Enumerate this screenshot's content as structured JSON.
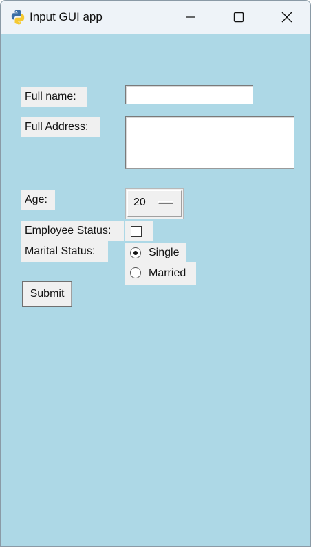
{
  "window": {
    "title": "Input GUI app",
    "app_icon": "python-icon",
    "controls": [
      "minimize-icon",
      "maximize-icon",
      "close-icon"
    ],
    "background_color": "#add8e6"
  },
  "form": {
    "full_name": {
      "label": "Full name:",
      "value": ""
    },
    "full_address": {
      "label": "Full Address:",
      "value": ""
    },
    "age": {
      "label": "Age:",
      "selected": "20"
    },
    "employee_status": {
      "label": "Employee Status:",
      "checked": false
    },
    "marital_status": {
      "label": "Marital Status:",
      "options": [
        {
          "label": "Single",
          "selected": true
        },
        {
          "label": "Married",
          "selected": false
        }
      ]
    },
    "submit_label": "Submit"
  }
}
